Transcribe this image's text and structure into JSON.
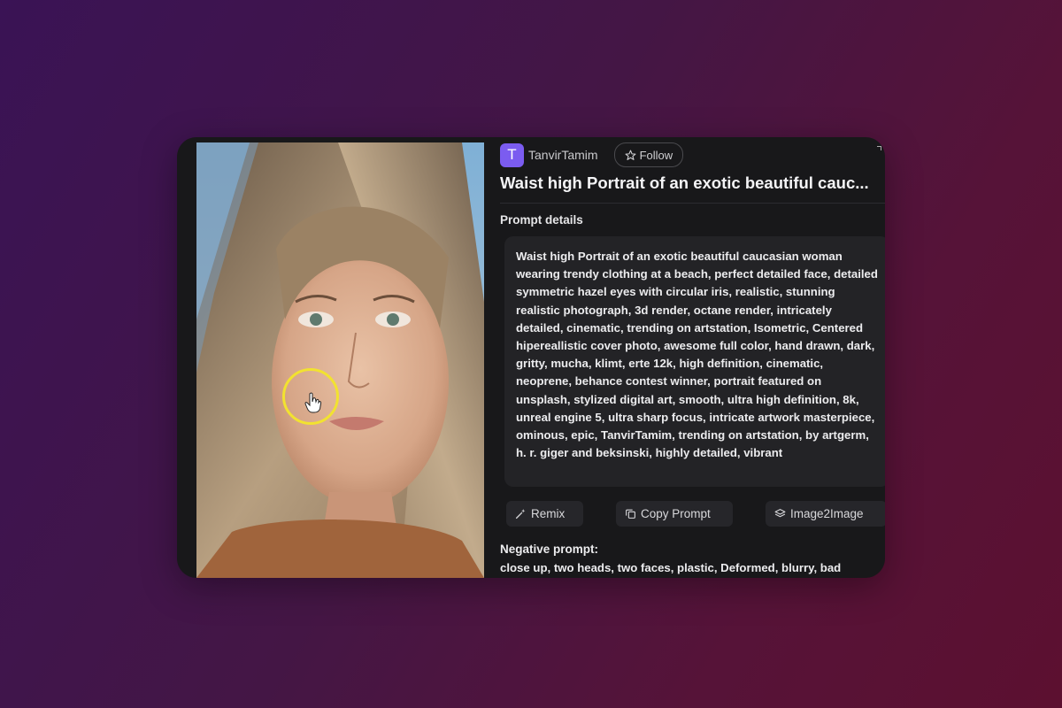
{
  "user": {
    "avatar_letter": "T",
    "name": "TanvirTamim",
    "follow_label": "Follow"
  },
  "title": "Waist high Portrait of an exotic beautiful cauc...",
  "prompt_details_label": "Prompt details",
  "prompt_text": "Waist high Portrait of an exotic beautiful caucasian woman wearing trendy clothing at a beach, perfect detailed face, detailed symmetric hazel eyes with circular iris, realistic, stunning realistic photograph, 3d render, octane render, intricately detailed, cinematic, trending on artstation, Isometric, Centered hipereallistic cover photo, awesome full color, hand drawn, dark, gritty, mucha, klimt, erte 12k, high definition, cinematic, neoprene, behance contest winner, portrait featured on unsplash, stylized digital art, smooth, ultra high definition, 8k, unreal engine 5, ultra sharp focus, intricate artwork masterpiece, ominous, epic, TanvirTamim, trending on artstation, by artgerm, h. r. giger and beksinski, highly detailed, vibrant",
  "actions": {
    "remix_label": "Remix",
    "copy_prompt_label": "Copy Prompt",
    "image2image_label": "Image2Image"
  },
  "negative_prompt_label": "Negative prompt:",
  "negative_prompt_text": "close up, two heads, two faces, plastic, Deformed, blurry, bad",
  "colors": {
    "panel_bg": "#18181a",
    "avatar_bg": "#7b5cf0",
    "cursor_ring": "#f2e230"
  },
  "icons": [
    "star-icon",
    "magic-wand-icon",
    "copy-icon",
    "layers-icon",
    "hand-cursor-icon"
  ]
}
